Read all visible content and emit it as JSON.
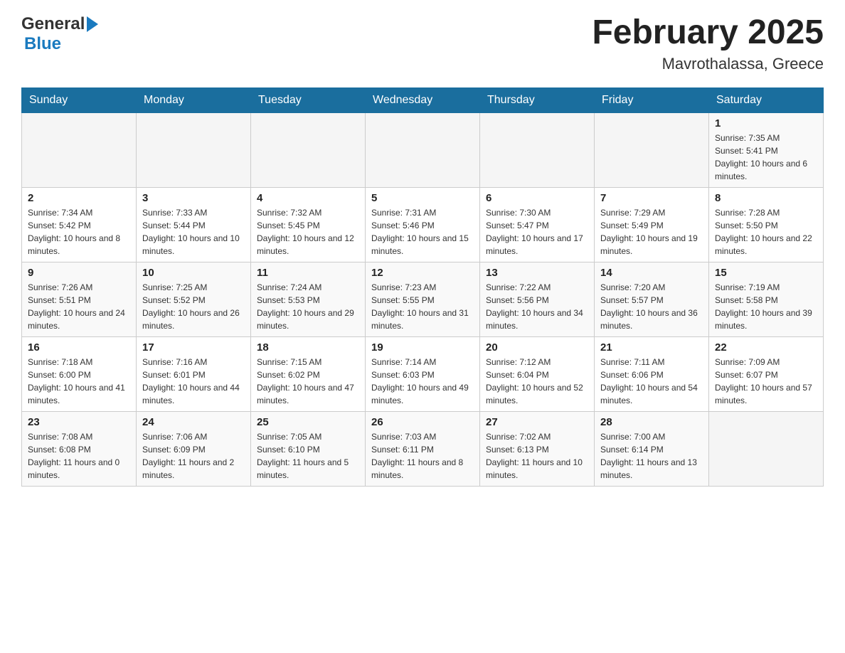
{
  "header": {
    "logo_general": "General",
    "logo_blue": "Blue",
    "month_title": "February 2025",
    "location": "Mavrothalassa, Greece"
  },
  "days_of_week": [
    "Sunday",
    "Monday",
    "Tuesday",
    "Wednesday",
    "Thursday",
    "Friday",
    "Saturday"
  ],
  "weeks": [
    [
      {
        "day": "",
        "sunrise": "",
        "sunset": "",
        "daylight": ""
      },
      {
        "day": "",
        "sunrise": "",
        "sunset": "",
        "daylight": ""
      },
      {
        "day": "",
        "sunrise": "",
        "sunset": "",
        "daylight": ""
      },
      {
        "day": "",
        "sunrise": "",
        "sunset": "",
        "daylight": ""
      },
      {
        "day": "",
        "sunrise": "",
        "sunset": "",
        "daylight": ""
      },
      {
        "day": "",
        "sunrise": "",
        "sunset": "",
        "daylight": ""
      },
      {
        "day": "1",
        "sunrise": "Sunrise: 7:35 AM",
        "sunset": "Sunset: 5:41 PM",
        "daylight": "Daylight: 10 hours and 6 minutes."
      }
    ],
    [
      {
        "day": "2",
        "sunrise": "Sunrise: 7:34 AM",
        "sunset": "Sunset: 5:42 PM",
        "daylight": "Daylight: 10 hours and 8 minutes."
      },
      {
        "day": "3",
        "sunrise": "Sunrise: 7:33 AM",
        "sunset": "Sunset: 5:44 PM",
        "daylight": "Daylight: 10 hours and 10 minutes."
      },
      {
        "day": "4",
        "sunrise": "Sunrise: 7:32 AM",
        "sunset": "Sunset: 5:45 PM",
        "daylight": "Daylight: 10 hours and 12 minutes."
      },
      {
        "day": "5",
        "sunrise": "Sunrise: 7:31 AM",
        "sunset": "Sunset: 5:46 PM",
        "daylight": "Daylight: 10 hours and 15 minutes."
      },
      {
        "day": "6",
        "sunrise": "Sunrise: 7:30 AM",
        "sunset": "Sunset: 5:47 PM",
        "daylight": "Daylight: 10 hours and 17 minutes."
      },
      {
        "day": "7",
        "sunrise": "Sunrise: 7:29 AM",
        "sunset": "Sunset: 5:49 PM",
        "daylight": "Daylight: 10 hours and 19 minutes."
      },
      {
        "day": "8",
        "sunrise": "Sunrise: 7:28 AM",
        "sunset": "Sunset: 5:50 PM",
        "daylight": "Daylight: 10 hours and 22 minutes."
      }
    ],
    [
      {
        "day": "9",
        "sunrise": "Sunrise: 7:26 AM",
        "sunset": "Sunset: 5:51 PM",
        "daylight": "Daylight: 10 hours and 24 minutes."
      },
      {
        "day": "10",
        "sunrise": "Sunrise: 7:25 AM",
        "sunset": "Sunset: 5:52 PM",
        "daylight": "Daylight: 10 hours and 26 minutes."
      },
      {
        "day": "11",
        "sunrise": "Sunrise: 7:24 AM",
        "sunset": "Sunset: 5:53 PM",
        "daylight": "Daylight: 10 hours and 29 minutes."
      },
      {
        "day": "12",
        "sunrise": "Sunrise: 7:23 AM",
        "sunset": "Sunset: 5:55 PM",
        "daylight": "Daylight: 10 hours and 31 minutes."
      },
      {
        "day": "13",
        "sunrise": "Sunrise: 7:22 AM",
        "sunset": "Sunset: 5:56 PM",
        "daylight": "Daylight: 10 hours and 34 minutes."
      },
      {
        "day": "14",
        "sunrise": "Sunrise: 7:20 AM",
        "sunset": "Sunset: 5:57 PM",
        "daylight": "Daylight: 10 hours and 36 minutes."
      },
      {
        "day": "15",
        "sunrise": "Sunrise: 7:19 AM",
        "sunset": "Sunset: 5:58 PM",
        "daylight": "Daylight: 10 hours and 39 minutes."
      }
    ],
    [
      {
        "day": "16",
        "sunrise": "Sunrise: 7:18 AM",
        "sunset": "Sunset: 6:00 PM",
        "daylight": "Daylight: 10 hours and 41 minutes."
      },
      {
        "day": "17",
        "sunrise": "Sunrise: 7:16 AM",
        "sunset": "Sunset: 6:01 PM",
        "daylight": "Daylight: 10 hours and 44 minutes."
      },
      {
        "day": "18",
        "sunrise": "Sunrise: 7:15 AM",
        "sunset": "Sunset: 6:02 PM",
        "daylight": "Daylight: 10 hours and 47 minutes."
      },
      {
        "day": "19",
        "sunrise": "Sunrise: 7:14 AM",
        "sunset": "Sunset: 6:03 PM",
        "daylight": "Daylight: 10 hours and 49 minutes."
      },
      {
        "day": "20",
        "sunrise": "Sunrise: 7:12 AM",
        "sunset": "Sunset: 6:04 PM",
        "daylight": "Daylight: 10 hours and 52 minutes."
      },
      {
        "day": "21",
        "sunrise": "Sunrise: 7:11 AM",
        "sunset": "Sunset: 6:06 PM",
        "daylight": "Daylight: 10 hours and 54 minutes."
      },
      {
        "day": "22",
        "sunrise": "Sunrise: 7:09 AM",
        "sunset": "Sunset: 6:07 PM",
        "daylight": "Daylight: 10 hours and 57 minutes."
      }
    ],
    [
      {
        "day": "23",
        "sunrise": "Sunrise: 7:08 AM",
        "sunset": "Sunset: 6:08 PM",
        "daylight": "Daylight: 11 hours and 0 minutes."
      },
      {
        "day": "24",
        "sunrise": "Sunrise: 7:06 AM",
        "sunset": "Sunset: 6:09 PM",
        "daylight": "Daylight: 11 hours and 2 minutes."
      },
      {
        "day": "25",
        "sunrise": "Sunrise: 7:05 AM",
        "sunset": "Sunset: 6:10 PM",
        "daylight": "Daylight: 11 hours and 5 minutes."
      },
      {
        "day": "26",
        "sunrise": "Sunrise: 7:03 AM",
        "sunset": "Sunset: 6:11 PM",
        "daylight": "Daylight: 11 hours and 8 minutes."
      },
      {
        "day": "27",
        "sunrise": "Sunrise: 7:02 AM",
        "sunset": "Sunset: 6:13 PM",
        "daylight": "Daylight: 11 hours and 10 minutes."
      },
      {
        "day": "28",
        "sunrise": "Sunrise: 7:00 AM",
        "sunset": "Sunset: 6:14 PM",
        "daylight": "Daylight: 11 hours and 13 minutes."
      },
      {
        "day": "",
        "sunrise": "",
        "sunset": "",
        "daylight": ""
      }
    ]
  ]
}
